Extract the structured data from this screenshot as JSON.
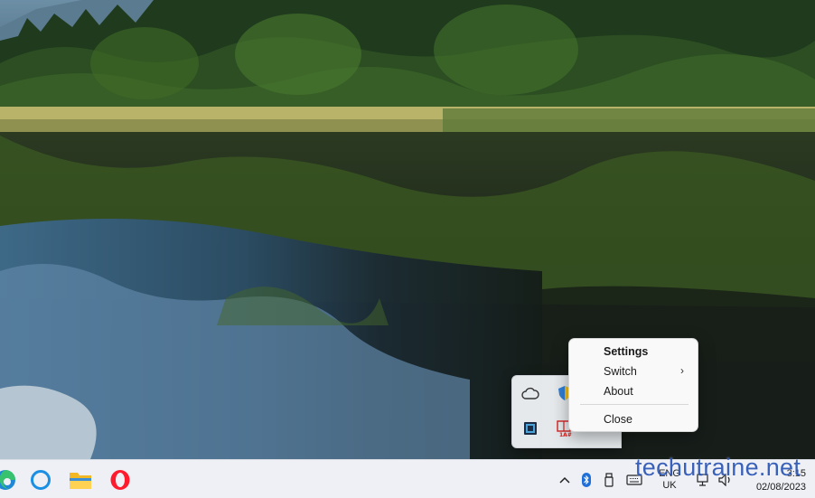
{
  "context_menu": {
    "items": [
      {
        "label": "Settings",
        "bold": true
      },
      {
        "label": "Switch",
        "submenu": true
      },
      {
        "label": "About"
      },
      {
        "label": "Close"
      }
    ]
  },
  "tray_overflow": {
    "icons": [
      "onedrive-icon",
      "security-shield-icon",
      "app-tray-icon",
      "character-counter-icon"
    ]
  },
  "taskbar": {
    "pinned_apps": [
      "edge-icon",
      "cortana-icon",
      "file-explorer-icon",
      "opera-icon"
    ],
    "system_tray": [
      "show-hidden-icons-chevron",
      "bluetooth-icon",
      "usb-drive-icon",
      "keyboard-icon"
    ],
    "language": {
      "line1": "ENG",
      "line2": "UK"
    },
    "status_icons": [
      "network-icon",
      "volume-icon"
    ],
    "clock": {
      "time": "3:15",
      "date": "02/08/2023"
    }
  },
  "watermark": "techutraine.net",
  "colors": {
    "taskbar_bg": "#eef0f5",
    "menu_bg": "#f9f9f9",
    "flyout_bg": "#eceff3",
    "watermark": "#2b55b5"
  }
}
